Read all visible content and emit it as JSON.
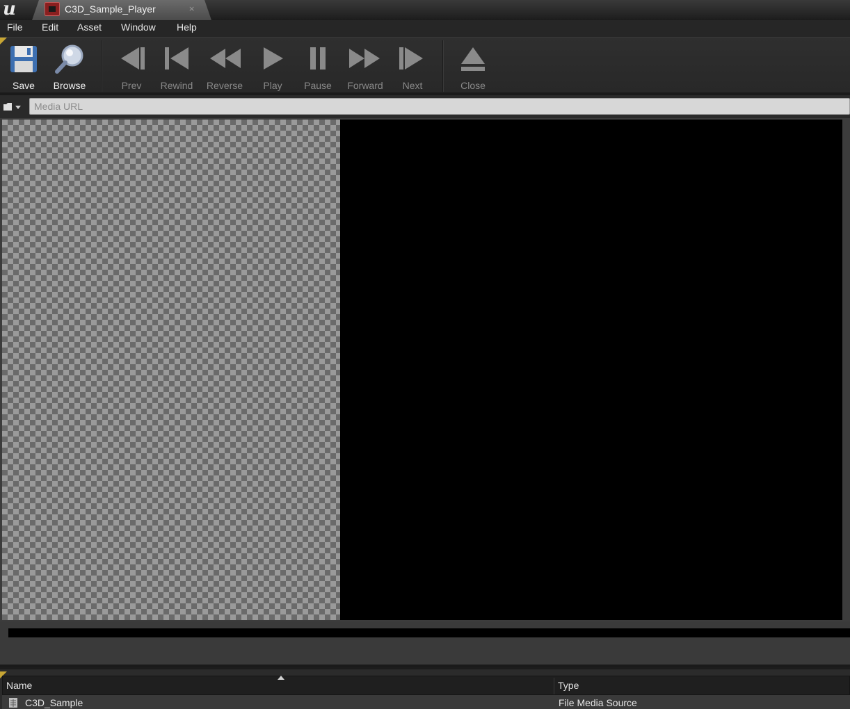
{
  "tab": {
    "title": "C3D_Sample_Player",
    "close_glyph": "×"
  },
  "menu": {
    "items": [
      "File",
      "Edit",
      "Asset",
      "Window",
      "Help"
    ]
  },
  "toolbar": {
    "buttons": [
      {
        "label": "Save",
        "icon": "save-icon",
        "enabled": true
      },
      {
        "label": "Browse",
        "icon": "browse-icon",
        "enabled": true
      },
      {
        "label": "Prev",
        "icon": "prev-icon",
        "enabled": false
      },
      {
        "label": "Rewind",
        "icon": "rewind-icon",
        "enabled": false
      },
      {
        "label": "Reverse",
        "icon": "reverse-icon",
        "enabled": false
      },
      {
        "label": "Play",
        "icon": "play-icon",
        "enabled": false
      },
      {
        "label": "Pause",
        "icon": "pause-icon",
        "enabled": false
      },
      {
        "label": "Forward",
        "icon": "forward-icon",
        "enabled": false
      },
      {
        "label": "Next",
        "icon": "next-icon",
        "enabled": false
      },
      {
        "label": "Close",
        "icon": "eject-icon",
        "enabled": false
      }
    ]
  },
  "url_bar": {
    "placeholder": "Media URL",
    "value": ""
  },
  "playlist": {
    "columns": [
      "Name",
      "Type"
    ],
    "rows": [
      {
        "name": "C3D_Sample",
        "type": "File Media Source"
      }
    ]
  },
  "colors": {
    "accent": "#c8a634",
    "video_bg": "#000000"
  }
}
